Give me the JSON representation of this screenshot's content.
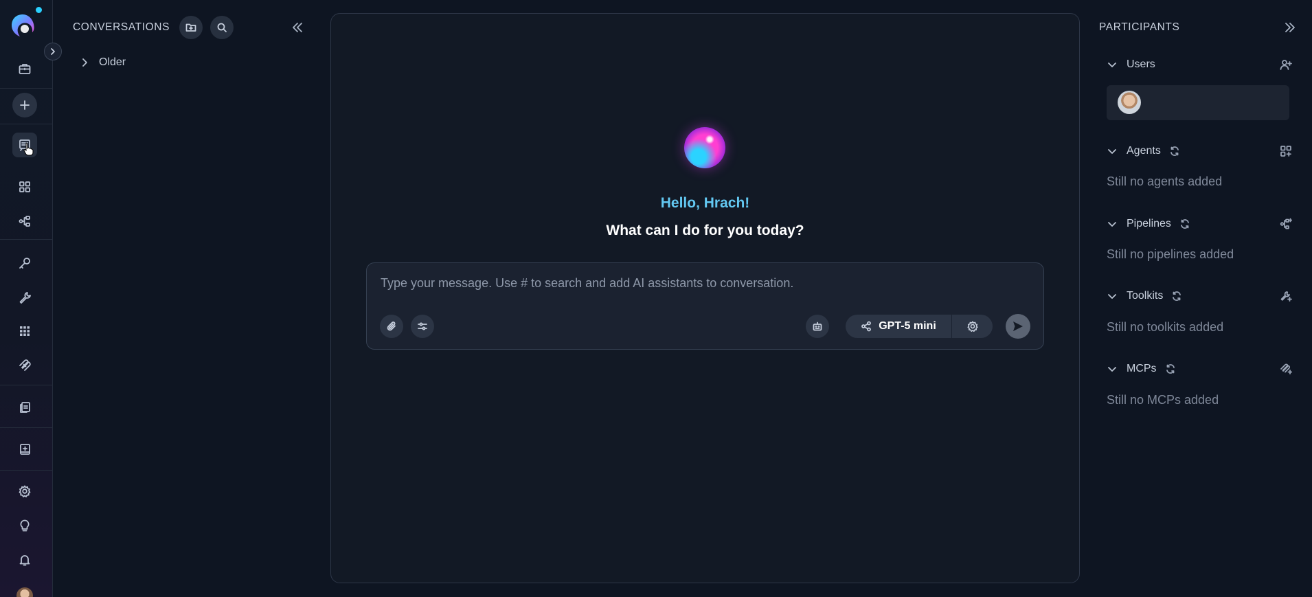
{
  "rail": {
    "items": [
      {
        "name": "projects",
        "icon": "briefcase-icon"
      },
      {
        "name": "new",
        "icon": "plus-icon"
      },
      {
        "name": "conversations",
        "icon": "chat-list-icon"
      },
      {
        "name": "agents",
        "icon": "grid-icon"
      },
      {
        "name": "pipelines",
        "icon": "pipeline-icon"
      },
      {
        "name": "credentials",
        "icon": "key-icon"
      },
      {
        "name": "toolkits",
        "icon": "wrench-icon"
      },
      {
        "name": "apps",
        "icon": "apps-grid-icon"
      },
      {
        "name": "mcps",
        "icon": "mcp-icon"
      },
      {
        "name": "artifacts",
        "icon": "documents-icon"
      },
      {
        "name": "prompts",
        "icon": "notebook-icon"
      },
      {
        "name": "settings",
        "icon": "gear-icon"
      },
      {
        "name": "tips",
        "icon": "lightbulb-icon"
      },
      {
        "name": "notifications",
        "icon": "bell-icon"
      }
    ],
    "accent_dot": "#2ad0ff"
  },
  "conversations": {
    "title": "CONVERSATIONS",
    "groups": [
      {
        "label": "Older"
      }
    ]
  },
  "main": {
    "greeting": "Hello, Hrach!",
    "subgreeting": "What can I do for you today?",
    "greeting_color": "#63c8f2",
    "composer": {
      "placeholder": "Type your message. Use # to search and add AI assistants to conversation.",
      "value": "",
      "model": "GPT-5 mini"
    }
  },
  "participants": {
    "title": "PARTICIPANTS",
    "sections": [
      {
        "label": "Users",
        "empty": ""
      },
      {
        "label": "Agents",
        "empty": "Still no agents added"
      },
      {
        "label": "Pipelines",
        "empty": "Still no pipelines added"
      },
      {
        "label": "Toolkits",
        "empty": "Still no toolkits added"
      },
      {
        "label": "MCPs",
        "empty": "Still no MCPs added"
      }
    ]
  }
}
